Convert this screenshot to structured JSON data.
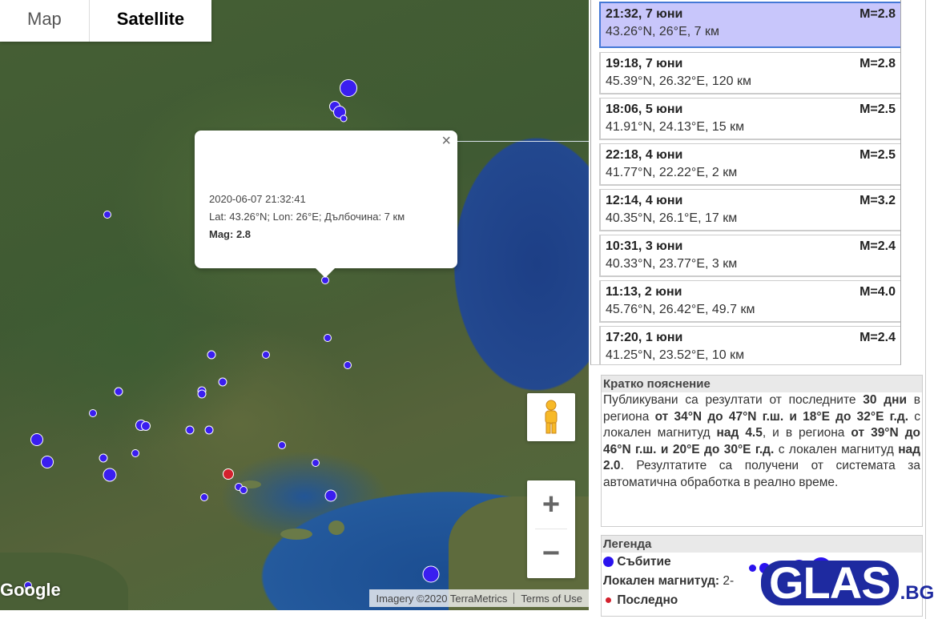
{
  "map": {
    "type_buttons": [
      "Map",
      "Satellite"
    ],
    "active_type": "Satellite",
    "popup": {
      "close": "×",
      "datetime": "2020-06-07 21:32:41",
      "location": "Lat: 43.26°N; Lon: 26°E; Дълбочина: 7 км",
      "mag": "Mag: 2.8"
    },
    "zoom_in": "+",
    "zoom_out": "−",
    "google_label": "Google",
    "imagery": "Imagery ©2020 TerraMetrics",
    "terms": "Terms of Use",
    "colors": {
      "event": "#3a1ef0",
      "last_event": "#d3212d"
    }
  },
  "events": [
    {
      "time": "21:32, 7 юни",
      "mag": "M=2.8",
      "loc": "43.26°N, 26°E, 7 км",
      "selected": true
    },
    {
      "time": "19:18, 7 юни",
      "mag": "M=2.8",
      "loc": "45.39°N, 26.32°E, 120 км"
    },
    {
      "time": "18:06, 5 юни",
      "mag": "M=2.5",
      "loc": "41.91°N, 24.13°E, 15 км"
    },
    {
      "time": "22:18, 4 юни",
      "mag": "M=2.5",
      "loc": "41.77°N, 22.22°E, 2 км"
    },
    {
      "time": "12:14, 4 юни",
      "mag": "M=3.2",
      "loc": "40.35°N, 26.1°E, 17 км"
    },
    {
      "time": "10:31, 3 юни",
      "mag": "M=2.4",
      "loc": "40.33°N, 23.77°E, 3 км"
    },
    {
      "time": "11:13, 2 юни",
      "mag": "M=4.0",
      "loc": "45.76°N, 26.42°E, 49.7 км"
    },
    {
      "time": "17:20, 1 юни",
      "mag": "M=2.4",
      "loc": "41.25°N, 23.52°E, 10 км"
    }
  ],
  "explanation": {
    "title": "Кратко пояснение",
    "p1": "Публикувани са резултати от последните ",
    "b1": "30 дни",
    "p2": " в региона ",
    "b2": "от 34°N до 47°N г.ш. и 18°E до 32°E г.д.",
    "p3": " с локален магнитуд ",
    "b3": "над 4.5",
    "p4": ", и в региона ",
    "b4": "от 39°N до 46°N г.ш. и 20°E до 30°E г.д.",
    "p5": " с локален магнитуд ",
    "b5": "над 2.0",
    "p6": ". Резултатите са получени от системата за автоматична обработка в реално време."
  },
  "legend": {
    "title": "Легенда",
    "event": "Събитие",
    "magnitude": "Локален магнитуд:",
    "magnitude_range": "2-",
    "last": "Последно"
  },
  "watermark": {
    "glas": "GLAS",
    "bg": ".BG"
  }
}
